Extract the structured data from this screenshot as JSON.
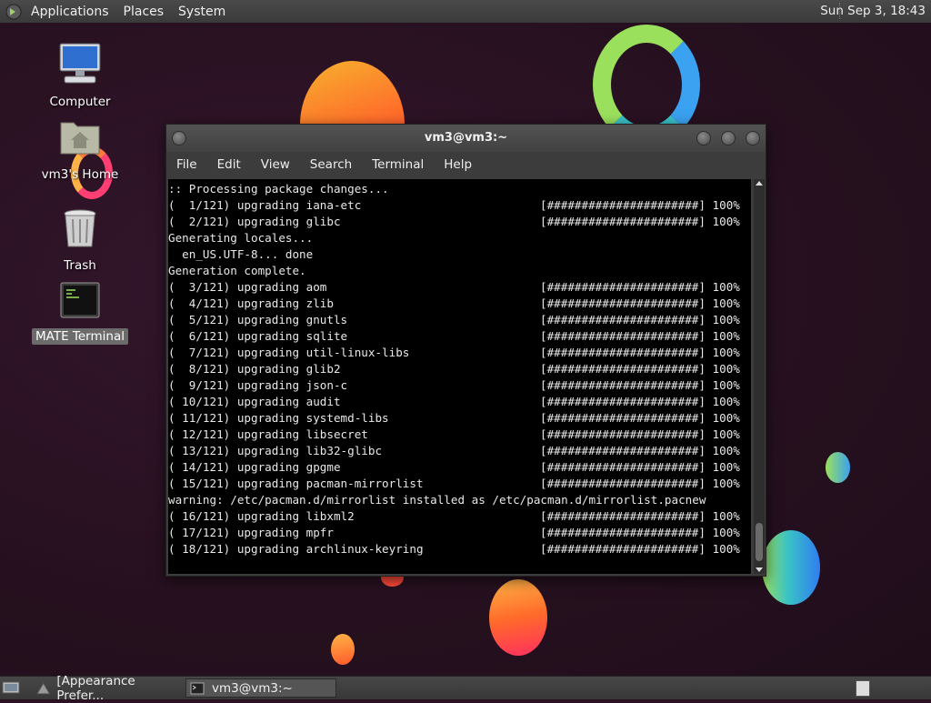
{
  "top_panel": {
    "menus": [
      "Applications",
      "Places",
      "System"
    ],
    "clock": "Sun Sep  3, 18:43"
  },
  "desktop": {
    "icons": [
      {
        "label": "Computer",
        "icon": "computer-icon"
      },
      {
        "label": "vm3's Home",
        "icon": "home-folder-icon"
      },
      {
        "label": "Trash",
        "icon": "trash-icon"
      },
      {
        "label": "MATE Terminal",
        "icon": "terminal-icon",
        "selected": true
      }
    ]
  },
  "terminal": {
    "title": "vm3@vm3:~",
    "menu": [
      "File",
      "Edit",
      "View",
      "Search",
      "Terminal",
      "Help"
    ],
    "progress_bar": "[######################]",
    "lines": [
      {
        "text": ":: Processing package changes...",
        "bar": false
      },
      {
        "text": "(  1/121) upgrading iana-etc",
        "bar": true
      },
      {
        "text": "(  2/121) upgrading glibc",
        "bar": true
      },
      {
        "text": "Generating locales...",
        "bar": false
      },
      {
        "text": "  en_US.UTF-8... done",
        "bar": false
      },
      {
        "text": "Generation complete.",
        "bar": false
      },
      {
        "text": "(  3/121) upgrading aom",
        "bar": true
      },
      {
        "text": "(  4/121) upgrading zlib",
        "bar": true
      },
      {
        "text": "(  5/121) upgrading gnutls",
        "bar": true
      },
      {
        "text": "(  6/121) upgrading sqlite",
        "bar": true
      },
      {
        "text": "(  7/121) upgrading util-linux-libs",
        "bar": true
      },
      {
        "text": "(  8/121) upgrading glib2",
        "bar": true
      },
      {
        "text": "(  9/121) upgrading json-c",
        "bar": true
      },
      {
        "text": "( 10/121) upgrading audit",
        "bar": true
      },
      {
        "text": "( 11/121) upgrading systemd-libs",
        "bar": true
      },
      {
        "text": "( 12/121) upgrading libsecret",
        "bar": true
      },
      {
        "text": "( 13/121) upgrading lib32-glibc",
        "bar": true
      },
      {
        "text": "( 14/121) upgrading gpgme",
        "bar": true
      },
      {
        "text": "( 15/121) upgrading pacman-mirrorlist",
        "bar": true
      },
      {
        "text": "warning: /etc/pacman.d/mirrorlist installed as /etc/pacman.d/mirrorlist.pacnew",
        "bar": false
      },
      {
        "text": "( 16/121) upgrading libxml2",
        "bar": true
      },
      {
        "text": "( 17/121) upgrading mpfr",
        "bar": true
      },
      {
        "text": "( 18/121) upgrading archlinux-keyring",
        "bar": true
      }
    ],
    "percent": "100%"
  },
  "taskbar": {
    "tasks": [
      {
        "label": "[Appearance Prefer...",
        "icon": "appearance-icon"
      },
      {
        "label": "vm3@vm3:~",
        "icon": "terminal-icon",
        "active": true
      }
    ]
  }
}
